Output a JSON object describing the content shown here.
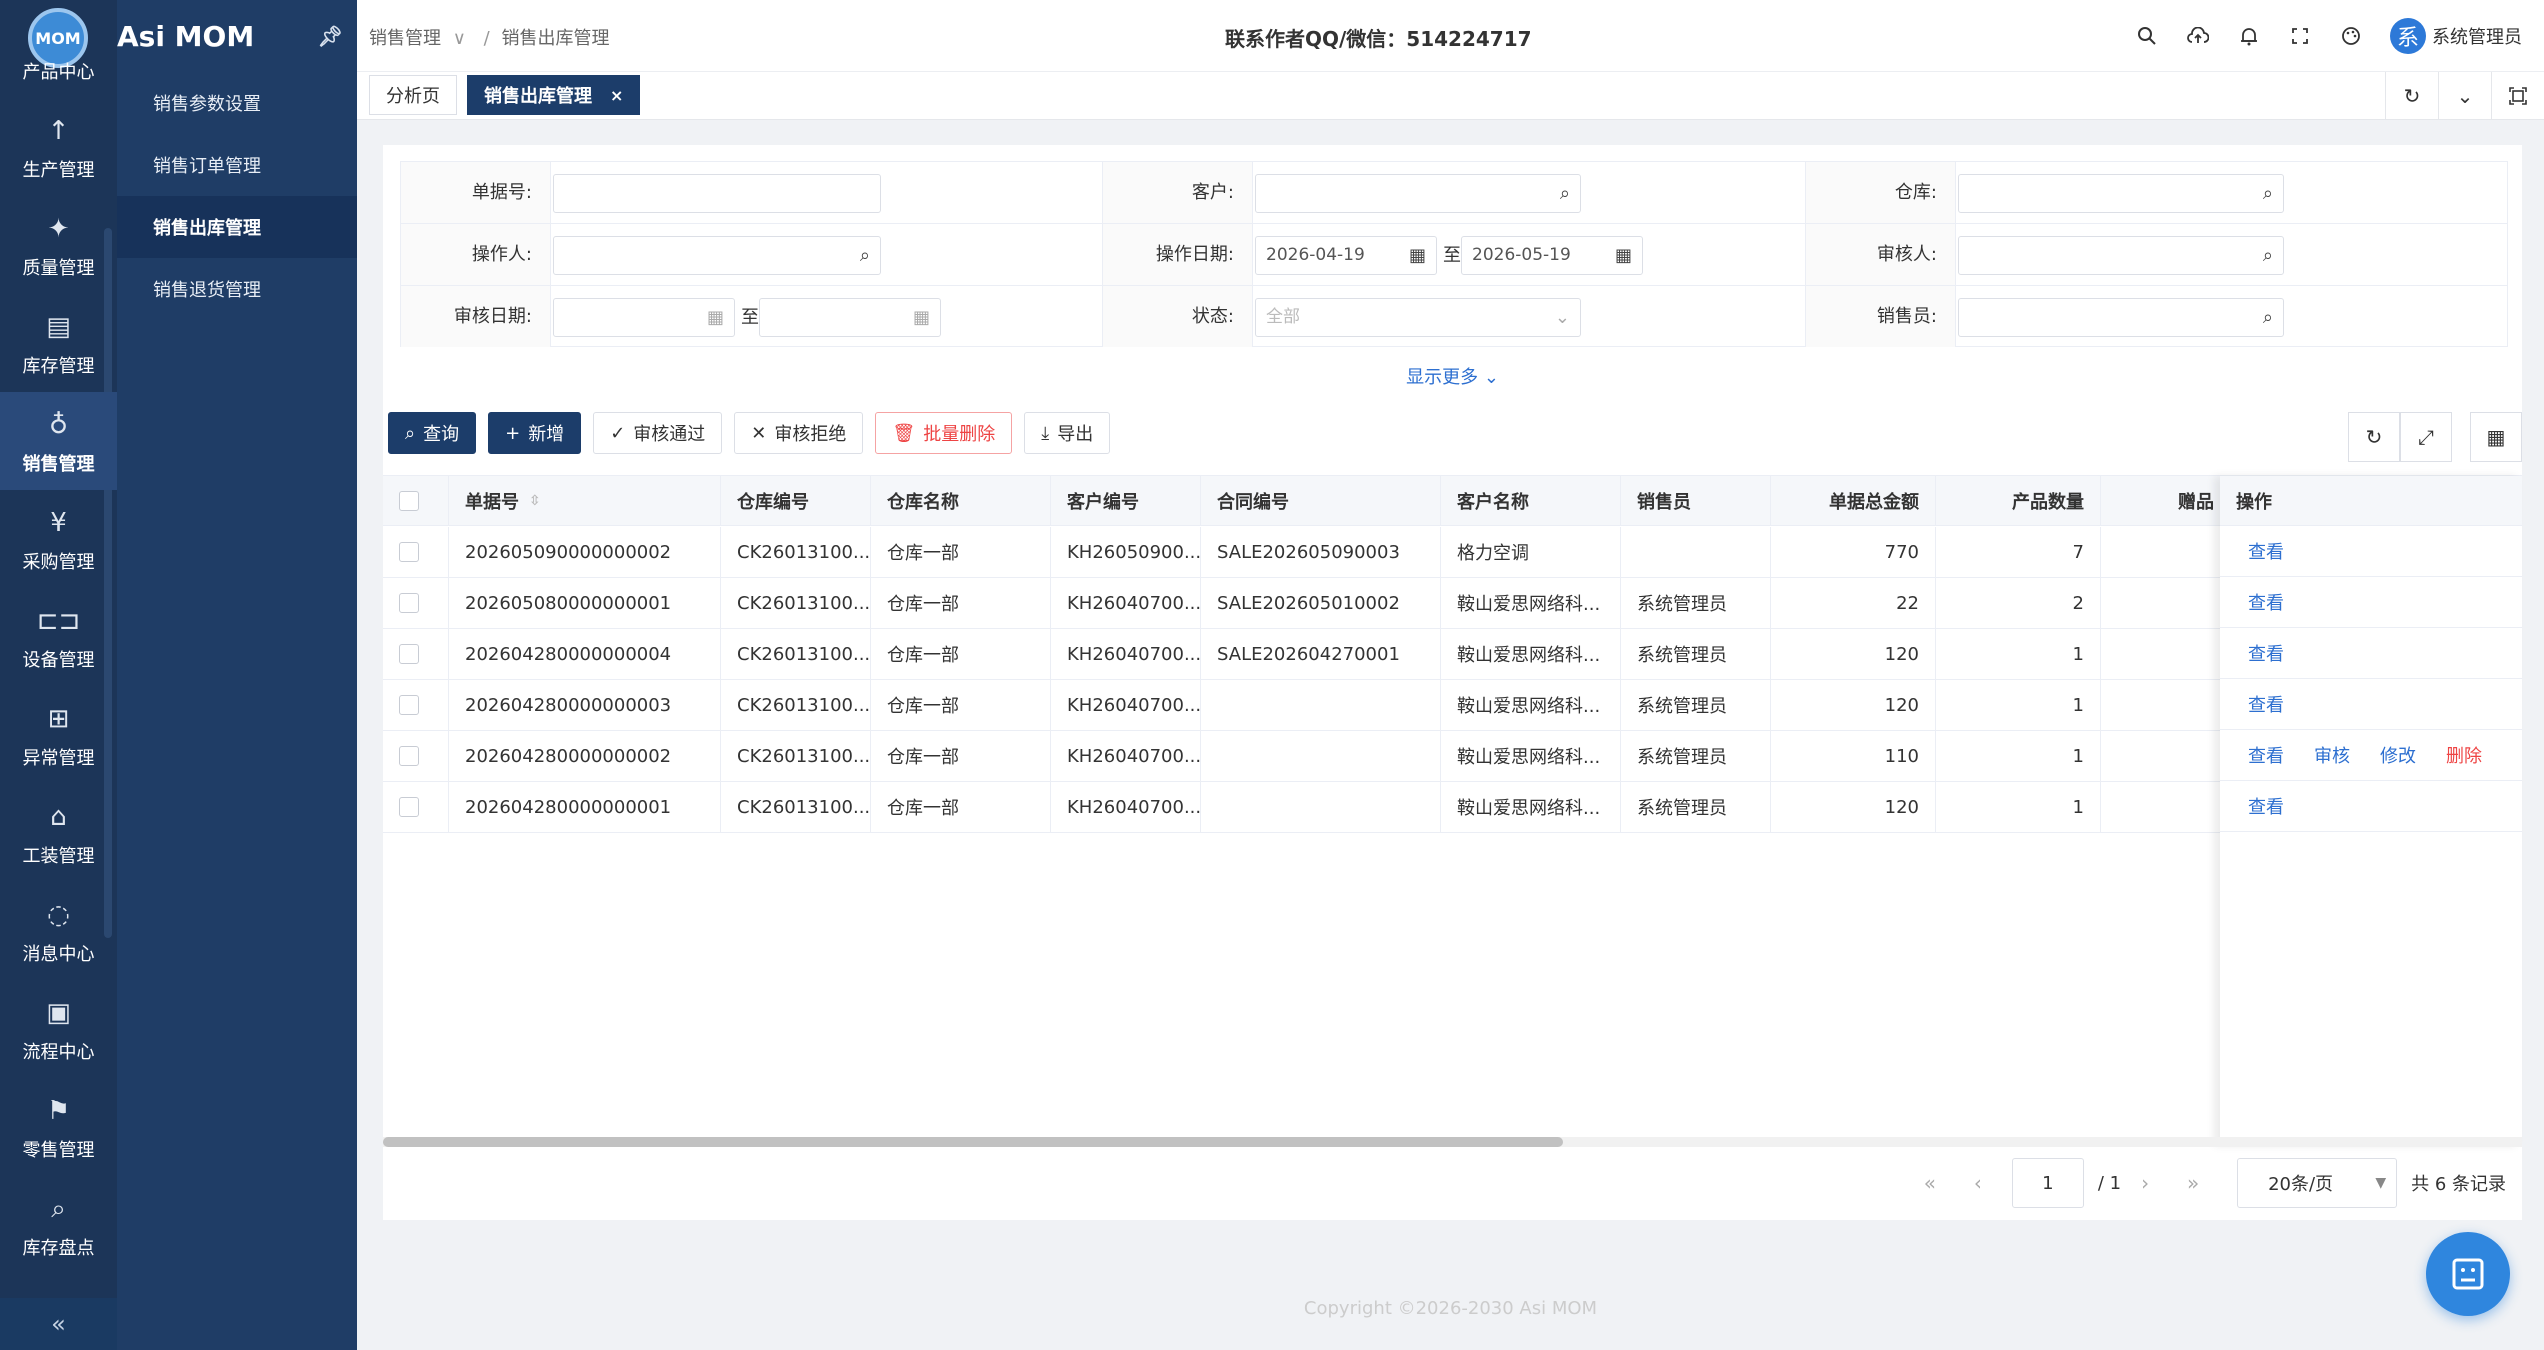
{
  "app": {
    "logo_text": "MOM",
    "brand": "Asi MOM"
  },
  "rail": {
    "items": [
      {
        "label": "产品中心",
        "icon": "product-icon",
        "glyph": ""
      },
      {
        "label": "生产管理",
        "icon": "arrow-up-icon",
        "glyph": "↑"
      },
      {
        "label": "质量管理",
        "icon": "quality-icon",
        "glyph": "✦"
      },
      {
        "label": "库存管理",
        "icon": "inventory-icon",
        "glyph": "▤"
      },
      {
        "label": "销售管理",
        "icon": "sales-icon",
        "glyph": "♁"
      },
      {
        "label": "采购管理",
        "icon": "purchase-icon",
        "glyph": "¥"
      },
      {
        "label": "设备管理",
        "icon": "equipment-icon",
        "glyph": "⊏⊐"
      },
      {
        "label": "异常管理",
        "icon": "exception-icon",
        "glyph": "⊞"
      },
      {
        "label": "工装管理",
        "icon": "tooling-icon",
        "glyph": "⌂"
      },
      {
        "label": "消息中心",
        "icon": "message-icon",
        "glyph": "◌"
      },
      {
        "label": "流程中心",
        "icon": "process-icon",
        "glyph": "▣"
      },
      {
        "label": "零售管理",
        "icon": "retail-icon",
        "glyph": "⚑"
      },
      {
        "label": "库存盘点",
        "icon": "stocktake-icon",
        "glyph": "⌕"
      }
    ],
    "collapse_glyph": "«"
  },
  "submenu": {
    "items": [
      "销售参数设置",
      "销售订单管理",
      "销售出库管理",
      "销售退货管理"
    ],
    "active_index": 2
  },
  "header": {
    "breadcrumb": [
      "销售管理",
      "销售出库管理"
    ],
    "contact": "联系作者QQ/微信：514224717",
    "avatar_char": "系",
    "username": "系统管理员"
  },
  "tabs": {
    "items": [
      "分析页",
      "销售出库管理"
    ],
    "close_glyph": "×"
  },
  "filters": {
    "doc_no": {
      "label": "单据号:",
      "value": ""
    },
    "customer": {
      "label": "客户:",
      "value": ""
    },
    "warehouse": {
      "label": "仓库:",
      "value": ""
    },
    "operator": {
      "label": "操作人:",
      "value": ""
    },
    "op_date": {
      "label": "操作日期:",
      "from": "2026-04-19",
      "to": "2026-05-19"
    },
    "reviewer": {
      "label": "审核人:",
      "value": ""
    },
    "review_date": {
      "label": "审核日期:",
      "from": "",
      "to": ""
    },
    "status": {
      "label": "状态:",
      "placeholder": "全部"
    },
    "salesperson": {
      "label": "销售员:",
      "value": ""
    },
    "to_word": "至",
    "show_more": "显示更多"
  },
  "toolbar": {
    "query": "查询",
    "add": "新增",
    "approve": "审核通过",
    "reject": "审核拒绝",
    "batch_delete": "批量删除",
    "export": "导出"
  },
  "table": {
    "columns": [
      "单据号",
      "仓库编号",
      "仓库名称",
      "客户编号",
      "合同编号",
      "客户名称",
      "销售员",
      "单据总金额",
      "产品数量",
      "赠品",
      "操作"
    ],
    "rows": [
      {
        "doc": "202605090000000002",
        "wh_code": "CK26013100...",
        "wh_name": "仓库一部",
        "cust_code": "KH26050900...",
        "contract": "SALE202605090003",
        "cust_name": "格力空调",
        "sales": "",
        "amount": "770",
        "qty": "7",
        "actions": [
          "查看"
        ]
      },
      {
        "doc": "202605080000000001",
        "wh_code": "CK26013100...",
        "wh_name": "仓库一部",
        "cust_code": "KH26040700...",
        "contract": "SALE202605010002",
        "cust_name": "鞍山爱思网络科...",
        "sales": "系统管理员",
        "amount": "22",
        "qty": "2",
        "actions": [
          "查看"
        ]
      },
      {
        "doc": "202604280000000004",
        "wh_code": "CK26013100...",
        "wh_name": "仓库一部",
        "cust_code": "KH26040700...",
        "contract": "SALE202604270001",
        "cust_name": "鞍山爱思网络科...",
        "sales": "系统管理员",
        "amount": "120",
        "qty": "1",
        "actions": [
          "查看"
        ]
      },
      {
        "doc": "202604280000000003",
        "wh_code": "CK26013100...",
        "wh_name": "仓库一部",
        "cust_code": "KH26040700...",
        "contract": "",
        "cust_name": "鞍山爱思网络科...",
        "sales": "系统管理员",
        "amount": "120",
        "qty": "1",
        "actions": [
          "查看"
        ]
      },
      {
        "doc": "202604280000000002",
        "wh_code": "CK26013100...",
        "wh_name": "仓库一部",
        "cust_code": "KH26040700...",
        "contract": "",
        "cust_name": "鞍山爱思网络科...",
        "sales": "系统管理员",
        "amount": "110",
        "qty": "1",
        "actions": [
          "查看",
          "审核",
          "修改",
          "删除"
        ]
      },
      {
        "doc": "202604280000000001",
        "wh_code": "CK26013100...",
        "wh_name": "仓库一部",
        "cust_code": "KH26040700...",
        "contract": "",
        "cust_name": "鞍山爱思网络科...",
        "sales": "系统管理员",
        "amount": "120",
        "qty": "1",
        "actions": [
          "查看"
        ]
      }
    ]
  },
  "pagination": {
    "page": "1",
    "pages": "/ 1",
    "page_size": "20条/页",
    "total": "共 6 条记录"
  },
  "footer": "Copyright ©2026-2030 Asi MOM",
  "colors": {
    "primary": "#1c3d6a",
    "rail_bg": "#1c3558",
    "link": "#2d6fd0",
    "danger": "#ee4444"
  }
}
